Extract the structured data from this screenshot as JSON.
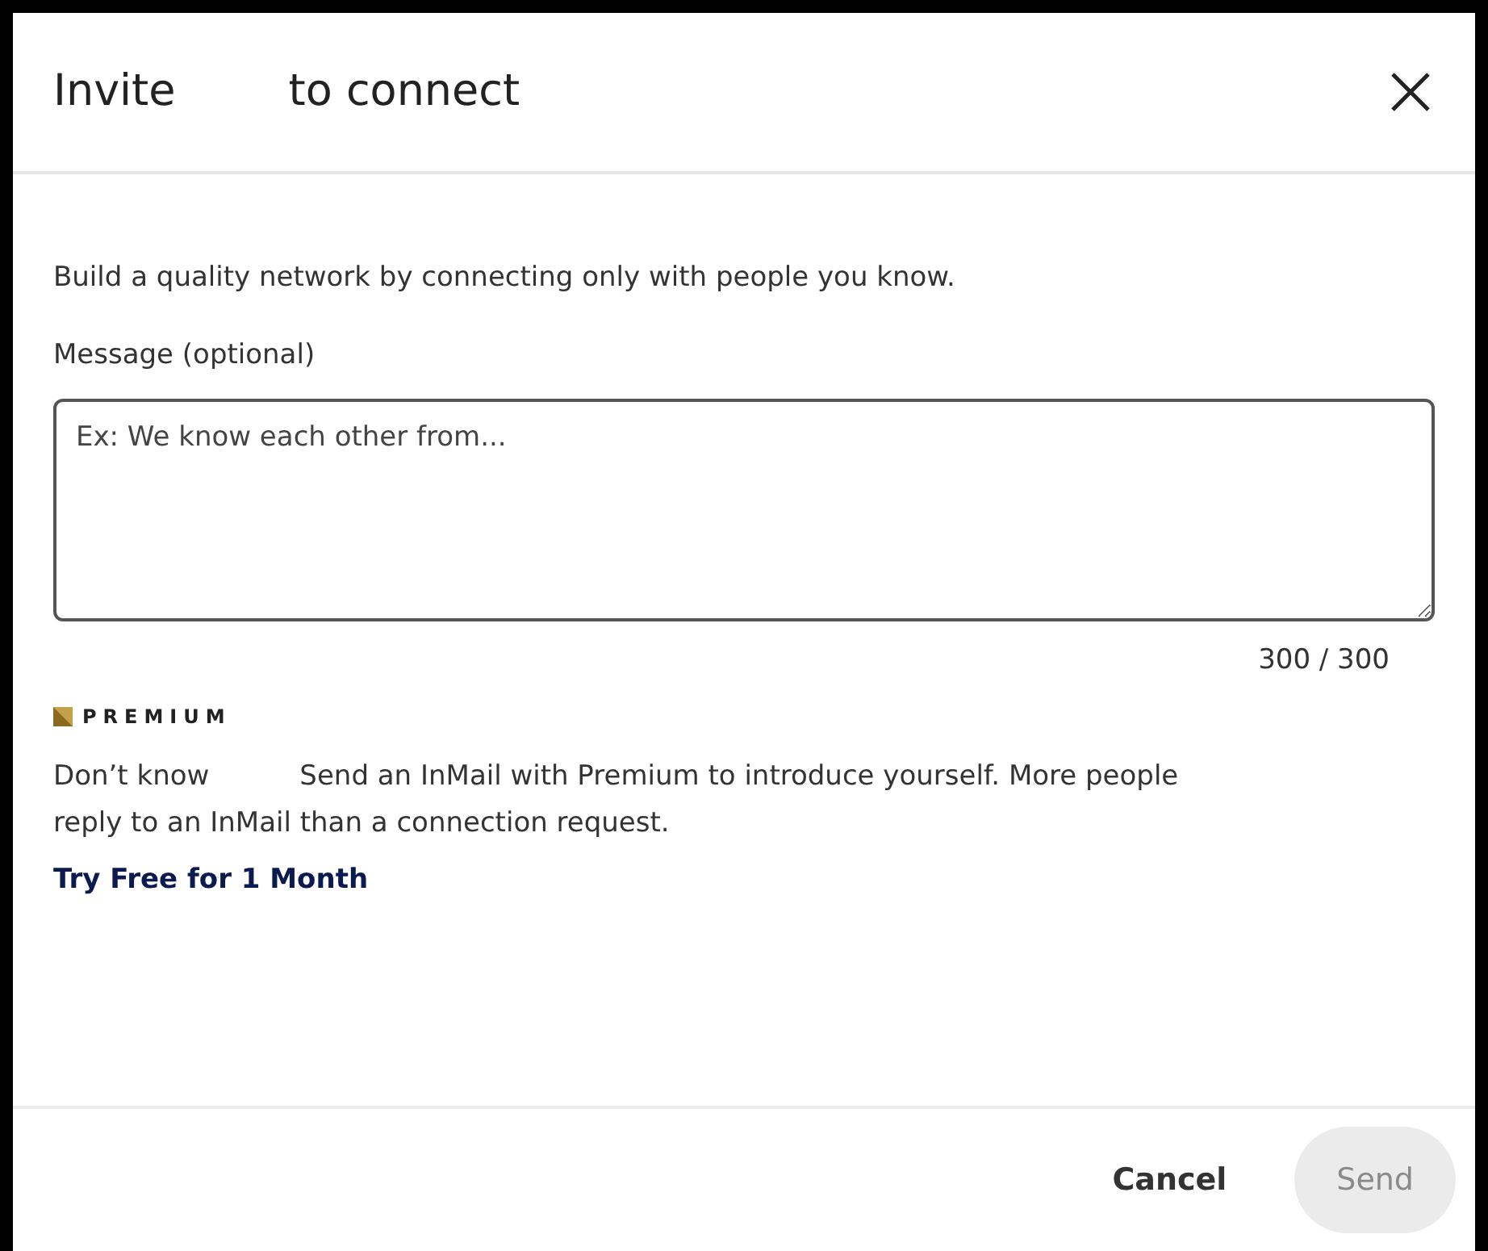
{
  "dialog": {
    "title_start": "Invite",
    "title_end": "to connect"
  },
  "intro": "Build a quality network by connecting only with people you know.",
  "message": {
    "label": "Message (optional)",
    "placeholder": "Ex: We know each other from...",
    "counter": "300 / 300"
  },
  "premium": {
    "badge": "PREMIUM",
    "prefix": "Don’t know",
    "text": "Send an InMail with Premium to introduce yourself. More people reply to an InMail than a connection request.",
    "link": "Try Free for 1 Month"
  },
  "buttons": [
    {
      "label": "Cancel",
      "kind": "secondary",
      "disabled": false
    },
    {
      "label": "Send",
      "kind": "primary",
      "disabled": true
    }
  ]
}
